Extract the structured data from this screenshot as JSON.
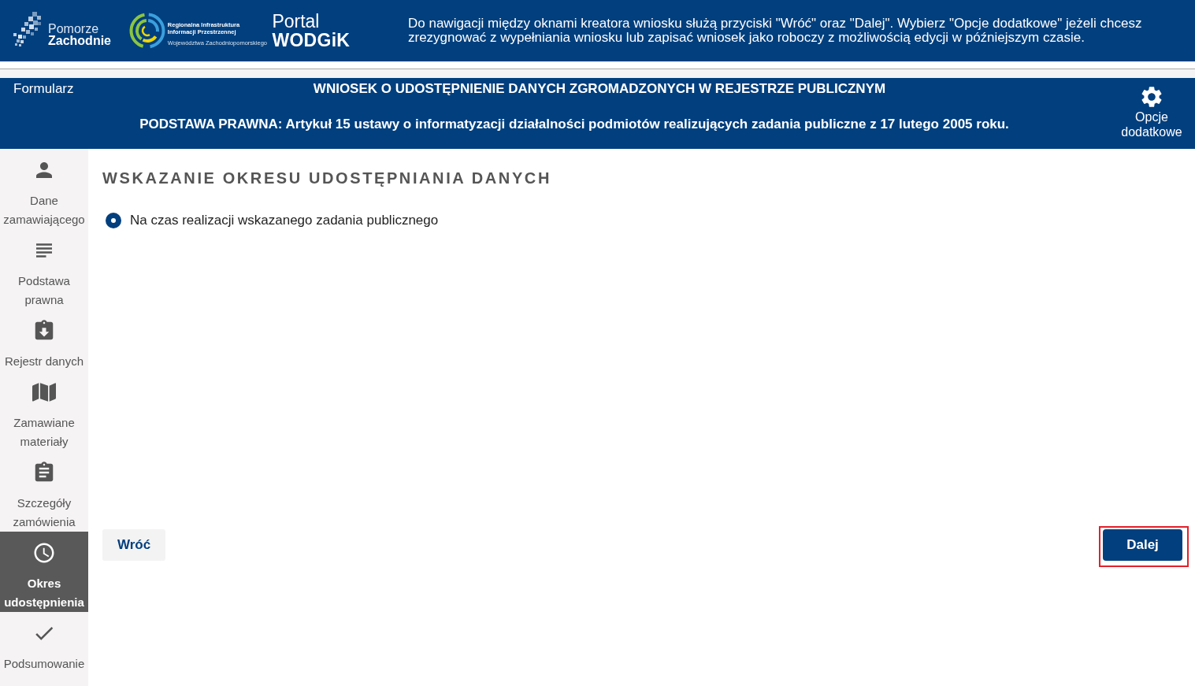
{
  "header": {
    "logos": [
      {
        "kind": "squares",
        "lines": [
          "Pomorze",
          "Zachodnie"
        ]
      },
      {
        "kind": "ring",
        "lines": [
          "Regionalna Infrastruktura",
          "Informacji Przestrzennej"
        ],
        "subline": "Województwa Zachodniopomorskiego"
      }
    ],
    "portal": {
      "line_1": "Portal",
      "line_2": "WODGiK"
    },
    "instructions": "Do nawigacji między oknami kreatora wniosku służą przyciski \"Wróć\" oraz \"Dalej\". Wybierz \"Opcje dodatkowe\" jeżeli chcesz zrezygnować z wypełniania wniosku lub zapisać wniosek jako roboczy z możliwością edycji w późniejszym czasie."
  },
  "form_bar": {
    "label": "Formularz",
    "title": "WNIOSEK O UDOSTĘPNIENIE DANYCH ZGROMADZONYCH W REJESTRZE PUBLICZNYM",
    "legal_basis": "PODSTAWA PRAWNA: Artykuł 15 ustawy o informatyzacji działalności podmiotów realizujących zadania publiczne z 17 lutego 2005 roku.",
    "options_button": "Opcje dodatkowe"
  },
  "steps": [
    {
      "label": "Dane zamawiającego",
      "selected": false
    },
    {
      "label": "Podstawa prawna",
      "selected": false
    },
    {
      "label": "Rejestr danych",
      "selected": false
    },
    {
      "label": "Zamawiane materiały",
      "selected": false
    },
    {
      "label": "Szczegóły zamówienia",
      "selected": false
    },
    {
      "label": "Okres udostępnienia",
      "selected": true
    },
    {
      "label": "Podsumowanie",
      "selected": false
    }
  ],
  "section": {
    "heading": "WSKAZANIE OKRESU UDOSTĘPNIANIA DANYCH",
    "options": [
      {
        "label": "Na czas realizacji wskazanego zadania publicznego",
        "selected": true
      }
    ]
  },
  "buttons": {
    "back": {
      "label": "Wróć"
    },
    "next": {
      "label": "Dalej",
      "highlighted": true
    }
  }
}
